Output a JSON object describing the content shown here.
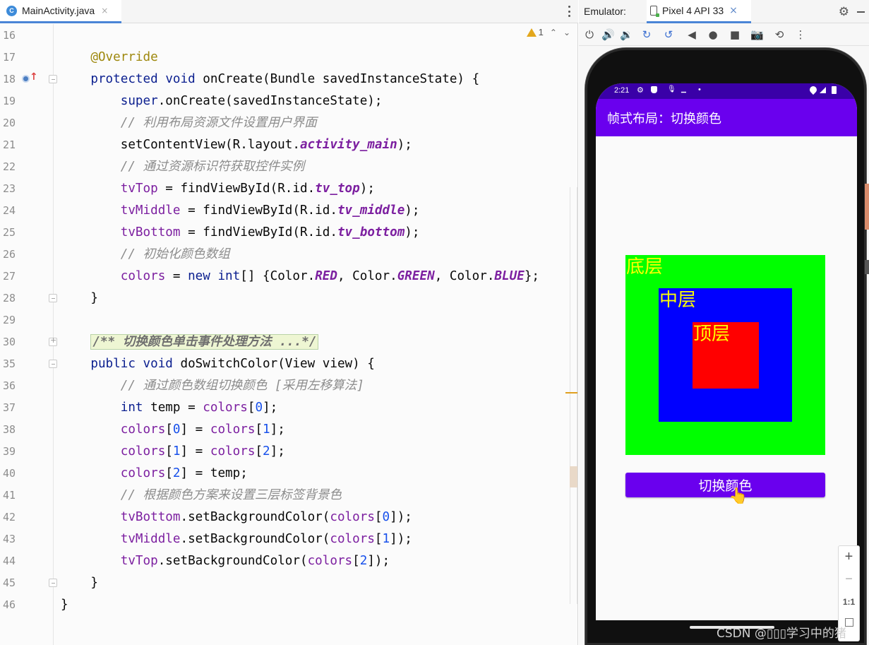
{
  "editor": {
    "tab_icon_letter": "C",
    "tab_name": "MainActivity.java",
    "tab_close": "×",
    "warning_count": "1",
    "lines": [
      {
        "n": "16",
        "tokens": []
      },
      {
        "n": "17",
        "tokens": [
          {
            "t": "    "
          },
          {
            "t": "@Override",
            "c": "anno"
          }
        ]
      },
      {
        "n": "18",
        "tokens": [
          {
            "t": "    "
          },
          {
            "t": "protected",
            "c": "kw"
          },
          {
            "t": " "
          },
          {
            "t": "void",
            "c": "kw"
          },
          {
            "t": " onCreate(Bundle savedInstanceState) {"
          }
        ]
      },
      {
        "n": "19",
        "tokens": [
          {
            "t": "        "
          },
          {
            "t": "super",
            "c": "kw"
          },
          {
            "t": ".onCreate(savedInstanceState);"
          }
        ]
      },
      {
        "n": "20",
        "tokens": [
          {
            "t": "        "
          },
          {
            "t": "// 利用布局资源文件设置用户界面",
            "c": "cmt"
          }
        ]
      },
      {
        "n": "21",
        "tokens": [
          {
            "t": "        setContentView(R.layout."
          },
          {
            "t": "activity_main",
            "c": "stat"
          },
          {
            "t": ");"
          }
        ]
      },
      {
        "n": "22",
        "tokens": [
          {
            "t": "        "
          },
          {
            "t": "// 通过资源标识符获取控件实例",
            "c": "cmt"
          }
        ]
      },
      {
        "n": "23",
        "tokens": [
          {
            "t": "        "
          },
          {
            "t": "tvTop",
            "c": "field"
          },
          {
            "t": " = findViewById(R.id."
          },
          {
            "t": "tv_top",
            "c": "stat"
          },
          {
            "t": ");"
          }
        ]
      },
      {
        "n": "24",
        "tokens": [
          {
            "t": "        "
          },
          {
            "t": "tvMiddle",
            "c": "field"
          },
          {
            "t": " = findViewById(R.id."
          },
          {
            "t": "tv_middle",
            "c": "stat"
          },
          {
            "t": ");"
          }
        ]
      },
      {
        "n": "25",
        "tokens": [
          {
            "t": "        "
          },
          {
            "t": "tvBottom",
            "c": "field"
          },
          {
            "t": " = findViewById(R.id."
          },
          {
            "t": "tv_bottom",
            "c": "stat"
          },
          {
            "t": ");"
          }
        ]
      },
      {
        "n": "26",
        "tokens": [
          {
            "t": "        "
          },
          {
            "t": "// 初始化颜色数组",
            "c": "cmt"
          }
        ]
      },
      {
        "n": "27",
        "tokens": [
          {
            "t": "        "
          },
          {
            "t": "colors",
            "c": "field"
          },
          {
            "t": " = "
          },
          {
            "t": "new",
            "c": "kw"
          },
          {
            "t": " "
          },
          {
            "t": "int",
            "c": "kw"
          },
          {
            "t": "[] {Color."
          },
          {
            "t": "RED",
            "c": "stat"
          },
          {
            "t": ", Color."
          },
          {
            "t": "GREEN",
            "c": "stat"
          },
          {
            "t": ", Color."
          },
          {
            "t": "BLUE",
            "c": "stat"
          },
          {
            "t": "};"
          }
        ]
      },
      {
        "n": "28",
        "tokens": [
          {
            "t": "    }"
          }
        ]
      },
      {
        "n": "29",
        "tokens": []
      },
      {
        "n": "30",
        "tokens": [
          {
            "t": "    "
          },
          {
            "t": "/** 切换颜色单击事件处理方法 ...*/",
            "c": "doccmt"
          }
        ]
      },
      {
        "n": "35",
        "tokens": [
          {
            "t": "    "
          },
          {
            "t": "public",
            "c": "kw"
          },
          {
            "t": " "
          },
          {
            "t": "void",
            "c": "kw"
          },
          {
            "t": " doSwitchColor(View view) {"
          }
        ]
      },
      {
        "n": "36",
        "tokens": [
          {
            "t": "        "
          },
          {
            "t": "// 通过颜色数组切换颜色 [采用左移算法]",
            "c": "cmt"
          }
        ]
      },
      {
        "n": "37",
        "tokens": [
          {
            "t": "        "
          },
          {
            "t": "int",
            "c": "kw"
          },
          {
            "t": " temp = "
          },
          {
            "t": "colors",
            "c": "field"
          },
          {
            "t": "["
          },
          {
            "t": "0",
            "c": "num"
          },
          {
            "t": "];"
          }
        ]
      },
      {
        "n": "38",
        "tokens": [
          {
            "t": "        "
          },
          {
            "t": "colors",
            "c": "field"
          },
          {
            "t": "["
          },
          {
            "t": "0",
            "c": "num"
          },
          {
            "t": "] = "
          },
          {
            "t": "colors",
            "c": "field"
          },
          {
            "t": "["
          },
          {
            "t": "1",
            "c": "num"
          },
          {
            "t": "];"
          }
        ]
      },
      {
        "n": "39",
        "tokens": [
          {
            "t": "        "
          },
          {
            "t": "colors",
            "c": "field"
          },
          {
            "t": "["
          },
          {
            "t": "1",
            "c": "num"
          },
          {
            "t": "] = "
          },
          {
            "t": "colors",
            "c": "field"
          },
          {
            "t": "["
          },
          {
            "t": "2",
            "c": "num"
          },
          {
            "t": "];"
          }
        ]
      },
      {
        "n": "40",
        "tokens": [
          {
            "t": "        "
          },
          {
            "t": "colors",
            "c": "field"
          },
          {
            "t": "["
          },
          {
            "t": "2",
            "c": "num"
          },
          {
            "t": "] = temp;"
          }
        ]
      },
      {
        "n": "41",
        "tokens": [
          {
            "t": "        "
          },
          {
            "t": "// 根据颜色方案来设置三层标签背景色",
            "c": "cmt"
          }
        ]
      },
      {
        "n": "42",
        "tokens": [
          {
            "t": "        "
          },
          {
            "t": "tvBottom",
            "c": "field"
          },
          {
            "t": ".setBackgroundColor("
          },
          {
            "t": "colors",
            "c": "field"
          },
          {
            "t": "["
          },
          {
            "t": "0",
            "c": "num"
          },
          {
            "t": "]);"
          }
        ]
      },
      {
        "n": "43",
        "tokens": [
          {
            "t": "        "
          },
          {
            "t": "tvMiddle",
            "c": "field"
          },
          {
            "t": ".setBackgroundColor("
          },
          {
            "t": "colors",
            "c": "field"
          },
          {
            "t": "["
          },
          {
            "t": "1",
            "c": "num"
          },
          {
            "t": "]);"
          }
        ]
      },
      {
        "n": "44",
        "tokens": [
          {
            "t": "        "
          },
          {
            "t": "tvTop",
            "c": "field"
          },
          {
            "t": ".setBackgroundColor("
          },
          {
            "t": "colors",
            "c": "field"
          },
          {
            "t": "["
          },
          {
            "t": "2",
            "c": "num"
          },
          {
            "t": "]);"
          }
        ]
      },
      {
        "n": "45",
        "tokens": [
          {
            "t": "    }"
          }
        ]
      },
      {
        "n": "46",
        "tokens": [
          {
            "t": "}"
          }
        ]
      }
    ]
  },
  "emulator": {
    "label": "Emulator:",
    "device_tab": "Pixel 4 API 33",
    "tab_close": "×",
    "toolbar_icons": [
      "power-icon",
      "volume-up-icon",
      "volume-down-icon",
      "rotate-left-icon",
      "rotate-right-icon",
      "back-icon",
      "home-icon",
      "overview-icon",
      "camera-icon",
      "snapshot-icon",
      "more-icon"
    ],
    "zoom": {
      "plus": "+",
      "minus": "−",
      "ratio": "1:1"
    }
  },
  "phone": {
    "time": "2:21",
    "dot": "•",
    "app_title": "帧式布局：切换颜色",
    "layers": {
      "bottom": {
        "label": "底层",
        "color": "#00ff00"
      },
      "middle": {
        "label": "中层",
        "color": "#0000ff"
      },
      "top": {
        "label": "顶层",
        "color": "#ff0000"
      },
      "label_color": "#ffff00"
    },
    "button_label": "切换颜色",
    "accent": "#6200ee"
  },
  "watermark": "CSDN @▯▯▯学习中的猪"
}
